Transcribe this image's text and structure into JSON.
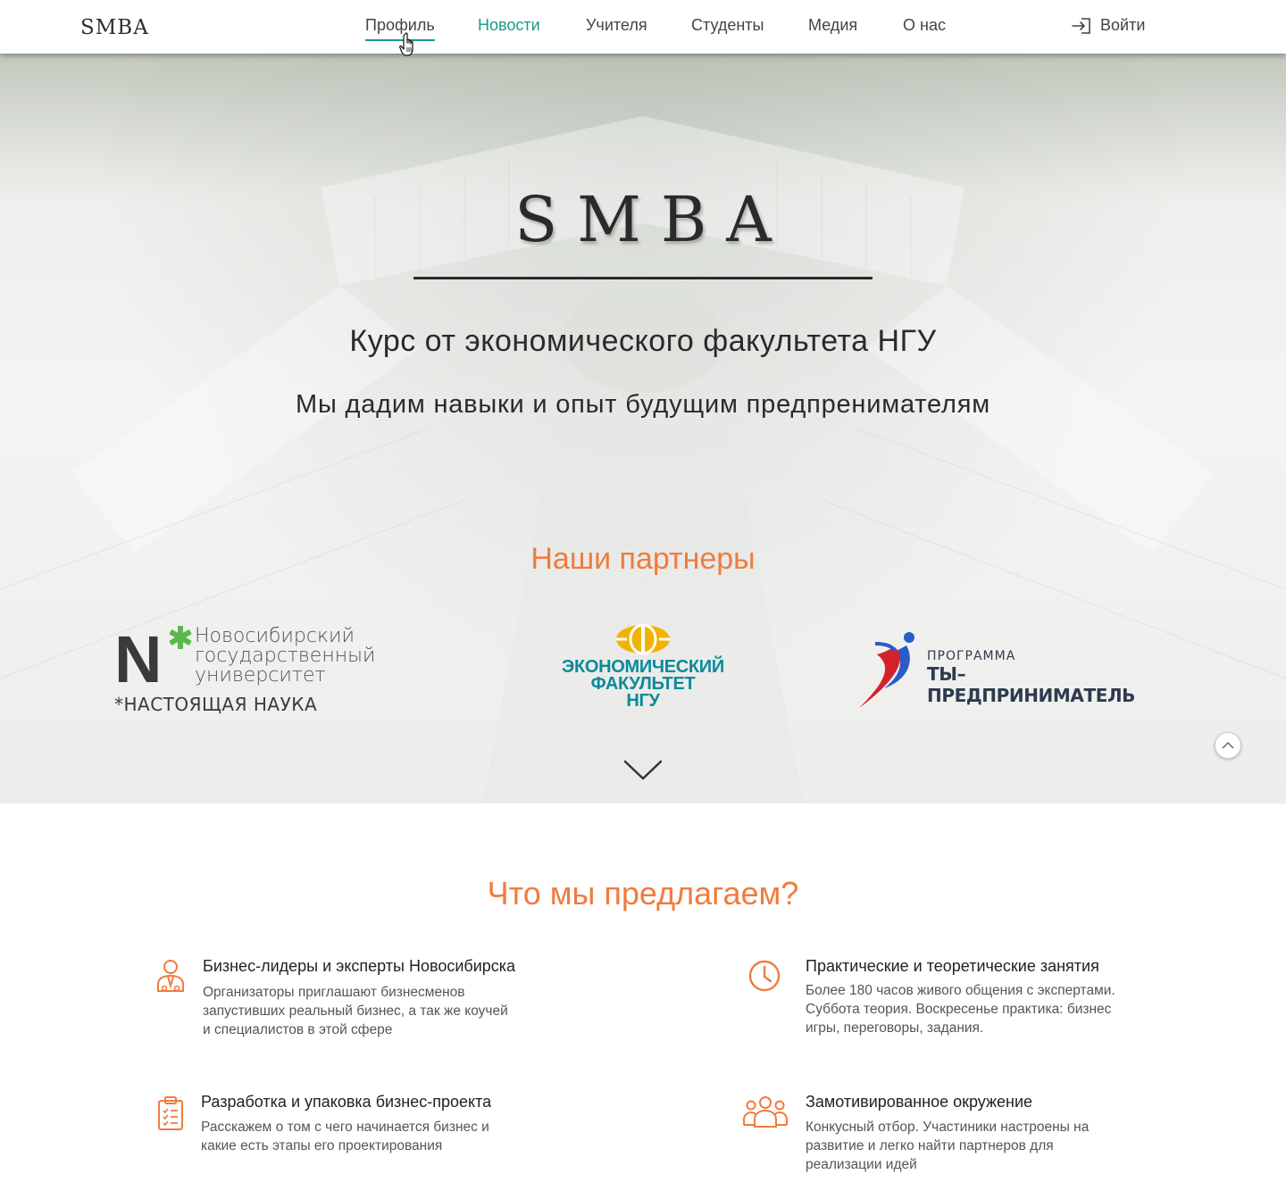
{
  "header": {
    "brand": "SMBA",
    "nav": [
      {
        "label": "Профиль"
      },
      {
        "label": "Новости"
      },
      {
        "label": "Учителя"
      },
      {
        "label": "Студенты"
      },
      {
        "label": "Медия"
      },
      {
        "label": "О нас"
      }
    ],
    "active_tab": "Профиль",
    "current_tab": "Новости",
    "login_label": "Войти"
  },
  "hero": {
    "title": "SMBA",
    "subtitle": "Курс от экономического факультета НГУ",
    "tagline": "Мы дадим навыки и опыт будущим предпренимателям",
    "partners_title": "Наши партнеры",
    "partners": [
      {
        "logo_letter": "N",
        "lines": [
          "Новосибирский",
          "государственный",
          "университет"
        ],
        "slogan": "*НАСТОЯЩАЯ НАУКА"
      },
      {
        "lines": [
          "ЭКОНОМИЧЕСКИЙ",
          "ФАКУЛЬТЕТ",
          "НГУ"
        ]
      },
      {
        "line1": "ПРОГРАММА",
        "line2": "ТЫ–ПРЕДПРИНИМАТЕЛЬ"
      }
    ]
  },
  "offer": {
    "title": "Что мы предлагаем?",
    "features": [
      {
        "icon": "business-person-icon",
        "title": "Бизнес-лидеры и эксперты Новосибирска",
        "lines": [
          "Организаторы приглашают бизнесменов",
          "запустивших реальный бизнес, а так же коучей",
          "и специалистов в этой сфере"
        ]
      },
      {
        "icon": "clock-icon",
        "title": "Практические и теоретические занятия",
        "lines": [
          "Более 180 часов живого общения с экспертами.",
          "Суббота теория. Воскресенье практика: бизнес",
          "игры, переговоры, задания."
        ]
      },
      {
        "icon": "clipboard-checklist-icon",
        "title": "Разработка и упаковка бизнес-проекта",
        "lines": [
          "Расскажем о том с чего начинается бизнес и",
          "какие есть этапы его проектирования"
        ]
      },
      {
        "icon": "group-icon",
        "title": "Замотивированное окружение",
        "lines": [
          "Конкусный отбор. Участиники настроены на",
          "развитие и легко найти партнеров для",
          "реализации идей"
        ]
      }
    ]
  },
  "colors": {
    "accent_orange": "#f07b3f",
    "accent_teal": "#1a9a88",
    "nsu_green": "#5bb84a",
    "econ_yellow": "#f0b400",
    "econ_teal": "#0b8a9a",
    "program_red": "#d3222b",
    "program_blue": "#2b5bc9"
  }
}
